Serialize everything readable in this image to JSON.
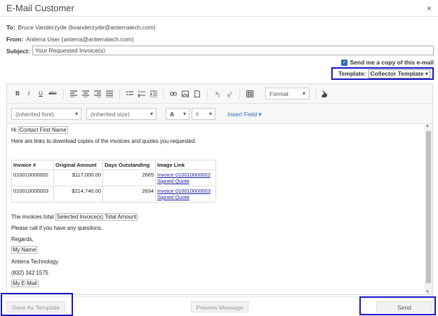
{
  "window": {
    "title": "E-Mail Customer",
    "close_glyph": "×"
  },
  "header": {
    "to_label": "To:",
    "to_value": "Bruce Vanderzyde (bvanderzyde@anterratech.com)",
    "from_label": "From:",
    "from_value": "Anterra User (anterra@anterratech.com)",
    "subject_label": "Subject:",
    "subject_value": "Your Requested Invoice(s)"
  },
  "copy_option": {
    "label": "Send me a copy of this e-mail",
    "checked": true
  },
  "template": {
    "label": "Template:",
    "selected": "Collector Template"
  },
  "toolbar": {
    "format_label": "Format",
    "font_label": "(inherited font)",
    "size_label": "(inherited size)",
    "insert_field_label": "Insert Field",
    "icons": [
      "bold-icon",
      "italic-icon",
      "underline-icon",
      "strikethrough-icon",
      "align-left-icon",
      "align-center-icon",
      "align-right-icon",
      "justify-icon",
      "bullet-list-icon",
      "numbered-list-icon",
      "indent-icon",
      "link-icon",
      "image-icon",
      "document-icon",
      "subscript-icon",
      "superscript-icon",
      "table-icon",
      "clear-format-icon",
      "font-color-icon",
      "highlight-icon"
    ]
  },
  "body": {
    "greeting": "Hi",
    "contact_field": "Contact First Name",
    "intro": "Here are links to download copies of the invoices and quotes you requested.",
    "table": {
      "headers": [
        "Invoice #",
        "Original Amount",
        "Days Outstanding",
        "Image Link"
      ],
      "rows": [
        {
          "invoice": "010010000002",
          "amount": "$117,000.00",
          "days": "2665",
          "link1": "Invoice 010010000002",
          "link2": "Signed Quote"
        },
        {
          "invoice": "010010000003",
          "amount": "$214,740.00",
          "days": "2634",
          "link1": "Invoice 010010000003",
          "link2": "Signed Quote"
        }
      ]
    },
    "total_text": "The invoices total",
    "total_field": "Selected Invoice(s) Total Amount",
    "call_text": "Please call if you have any questions.",
    "regards": "Regards,",
    "my_name_field": "My Name",
    "company": "Anterra Technology",
    "phone": "(832) 342 1575",
    "email_field": "My E-Mail"
  },
  "footer": {
    "save_template_label": "Save As Template",
    "preview_label": "Preview Message",
    "send_label": "Send"
  },
  "colors": {
    "highlight_border": "#1515c8",
    "link": "#1a1aa0",
    "accent": "#2a6ebb"
  }
}
